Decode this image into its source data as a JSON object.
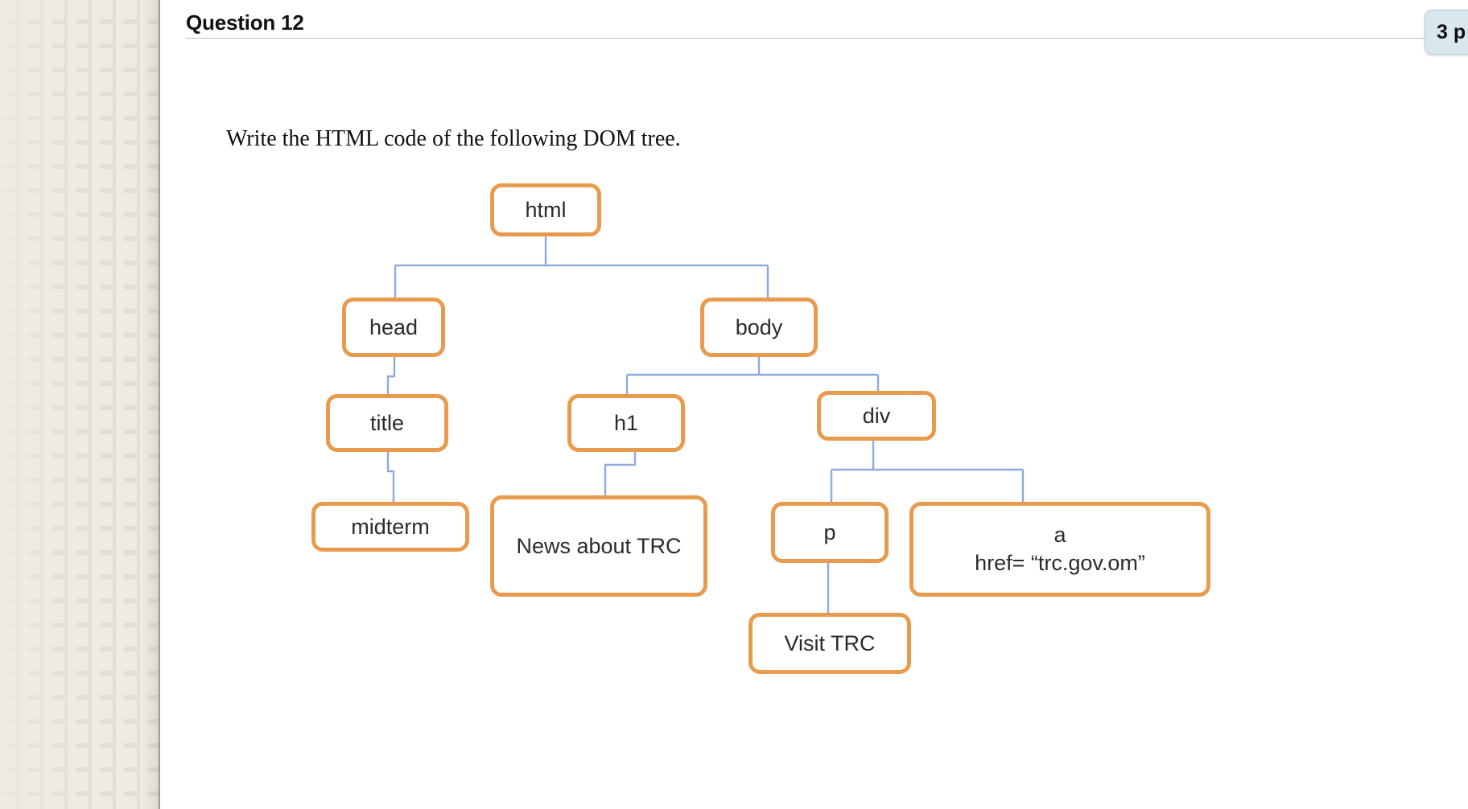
{
  "header": {
    "question_title": "Question 12",
    "points_badge": "3 p"
  },
  "prompt": {
    "text": "Write the HTML code of the following DOM tree."
  },
  "colors": {
    "node_border": "#e89b4e",
    "connector": "#8faadc",
    "sidebar_bg": "#edebe3",
    "badge_bg": "#d9e7ee"
  },
  "diagram": {
    "title": "DOM tree",
    "nodes": [
      {
        "id": "html",
        "label": "html",
        "label2": ""
      },
      {
        "id": "head",
        "label": "head",
        "label2": ""
      },
      {
        "id": "body",
        "label": "body",
        "label2": ""
      },
      {
        "id": "title",
        "label": "title",
        "label2": ""
      },
      {
        "id": "h1",
        "label": "h1",
        "label2": ""
      },
      {
        "id": "div",
        "label": "div",
        "label2": ""
      },
      {
        "id": "midterm",
        "label": "midterm",
        "label2": ""
      },
      {
        "id": "news",
        "label": "News about TRC",
        "label2": ""
      },
      {
        "id": "p",
        "label": "p",
        "label2": ""
      },
      {
        "id": "anchor",
        "label": "a",
        "label2": "href= “trc.gov.om”"
      },
      {
        "id": "visit",
        "label": "Visit TRC",
        "label2": ""
      }
    ],
    "edges": [
      {
        "from": "html",
        "to": "head"
      },
      {
        "from": "html",
        "to": "body"
      },
      {
        "from": "head",
        "to": "title"
      },
      {
        "from": "title",
        "to": "midterm"
      },
      {
        "from": "body",
        "to": "h1"
      },
      {
        "from": "body",
        "to": "div"
      },
      {
        "from": "h1",
        "to": "news"
      },
      {
        "from": "div",
        "to": "p"
      },
      {
        "from": "div",
        "to": "anchor"
      },
      {
        "from": "p",
        "to": "visit"
      }
    ]
  }
}
